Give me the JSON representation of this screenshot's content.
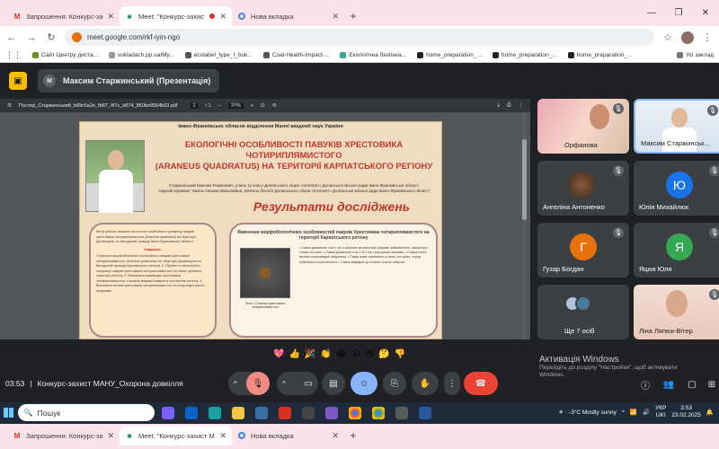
{
  "browser": {
    "tabs": [
      {
        "icon": "gmail-icon",
        "title": "Запрошення: Конкурс-захист М",
        "active": false
      },
      {
        "icon": "meet-icon",
        "title": "Meet: \"Конкурс-захист МА",
        "active": true
      },
      {
        "icon": "chrome-icon",
        "title": "Нова вкладка",
        "active": false
      }
    ],
    "url": "meet.google.com/rkf-iyin-ngo",
    "bookmarks": [
      "Сайт Центру диста...",
      "vukladach.pp.ua/My...",
      "ecolabel_type_I_buk...",
      "Coal-Health-Impact-...",
      "Екологічна безпека...",
      "home_preparation_...",
      "home_preparation_...",
      "home_preparation_..."
    ],
    "bookmarks_other": "Усі заклад"
  },
  "meet": {
    "presenter_label": "Максим Старжинський (Презентація)",
    "presenter_initial": "М",
    "meeting_time": "03:53",
    "meeting_name": "Конкурс-захист МАНУ_Охорона довкілля",
    "reactions": [
      "💖",
      "👍",
      "🎉",
      "👏",
      "😂",
      "😮",
      "😢",
      "🤔",
      "👎"
    ]
  },
  "pdf": {
    "filename": "Постер_Старжинський_b69c5a2e_fb87_4f7c_b874_860be9564b53.pdf",
    "page": "1",
    "page_total": "/ 1",
    "zoom": "37%"
  },
  "poster": {
    "institution": "Івано-Франківське обласне відділення Малої академії наук України",
    "title_line1": "ЕКОЛОГІЧНІ ОСОБЛИВОСТІ ПАВУКІВ ХРЕСТОВИКА ЧОТИРИПЛЯМИСТОГО",
    "title_line2": "(ARANEUS QUADRATUS) НА ТЕРИТОРІЇ КАРПАТСЬКОГО РЕГІОНУ",
    "author": "Старжинський Максим Романович, учень 11 класу Долинського ліцею «Інтелект» Долинської міської ради Івано-Франківської області",
    "supervisor": "Наукові керівник: Чмиль Оксана Миколаївна, вчитель біології Долинського ліцею «Інтелект» Долинської міської ради Івано-Франківської області",
    "results_heading": "Результати досліджень",
    "aim_text": "Мета роботи: вивчити екологічні особливості розвитку павуків хрестовика чотириплямистого (Araneus quadratus) на території Долинщини та Вигодській громаді Івано-Франківської області.",
    "tasks_heading": "Завдання:",
    "tasks_text": "1.Вивчити морфобіологічні особливості павуків хрестовика чотириплямистого (Araneus quadratus) на території Долинщини та Вигодській громаді Карпатського регіону. 2. Провести чисельність популяції павуків хрестовика чотириплямистого на різних ділянках території регіону. 3. Визначити взаємодію хрестовика чотириплямистого з іншими видами павуків в екосистемі регіону. 4. Визначити вплив хрестовика чотириплямистого на популяцію різних шкідників.",
    "box2_heading": "Вивчення морфобіологічних особливостей павуків Хрестовика чотириплямистого на території Карпатського регіону",
    "photo_caption": "Фото 1.Самиця хрестовика чотириплямистого",
    "facts_text": "• Самка довжиною тіла 1 см з чорними мітками має яскраве забарвлення, характерні плями на спині. • Самка довжиною тіла 1,5-2 см з короткими лапками. • Самка плете велике колесовидне павутиння. • Павук живе переважно в лісах, на луках, серед трав'янистої рослинності. • Самка виводить до кількох сотень павучат."
  },
  "participants": [
    {
      "name": "Орфанова",
      "kind": "video",
      "muted": true
    },
    {
      "name": "Максим Старжинськ...",
      "kind": "video",
      "muted": true,
      "selected": true
    },
    {
      "name": "Ангеліна Антоненко",
      "kind": "video",
      "muted": true
    },
    {
      "name": "Юлія Михайлюк",
      "kind": "avatar",
      "initial": "Ю",
      "color": "#1a73e8",
      "muted": true
    },
    {
      "name": "Гузар Богдан",
      "kind": "avatar",
      "initial": "Г",
      "color": "#e8710a",
      "muted": true
    },
    {
      "name": "Яцюк Юля",
      "kind": "avatar",
      "initial": "Я",
      "color": "#34a853",
      "muted": true
    },
    {
      "name": "Ще 7 осіб",
      "kind": "more"
    },
    {
      "name": "Ліна Ляпюк-Вітер",
      "kind": "video",
      "muted": true
    }
  ],
  "windows": {
    "activation_title": "Активація Windows",
    "activation_text1": "Перейдіть до розділу \"Настройки\", щоб активувати",
    "activation_text2": "Windows.",
    "search_placeholder": "Пошук",
    "weather": "-3°C  Mostly sunny",
    "lang": "УКР",
    "lang2": "UKI",
    "time": "3:53",
    "date": "23.02.2025"
  },
  "colors": {
    "end_call": "#ea4335",
    "mic_off": "#f28b82",
    "accent": "#8ab4f8"
  }
}
